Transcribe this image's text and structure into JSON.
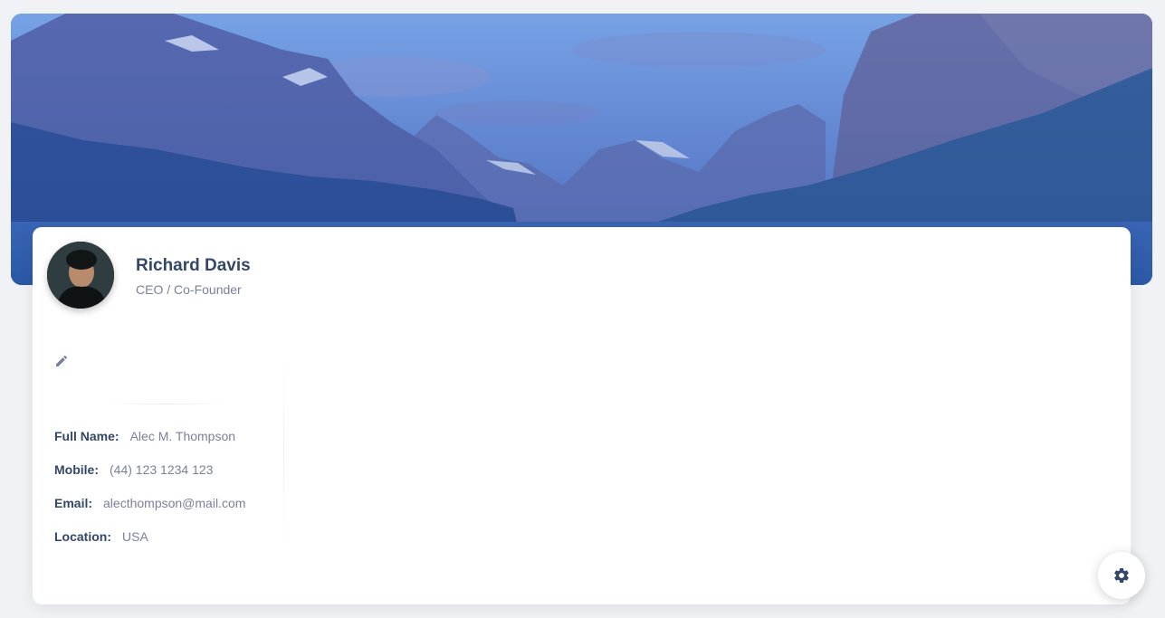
{
  "profile": {
    "name": "Richard Davis",
    "role": "CEO / Co-Founder",
    "avatar_icon": "person-avatar"
  },
  "info": {
    "full_name_label": "Full Name:",
    "full_name": "Alec M. Thompson",
    "mobile_label": "Mobile:",
    "mobile": "(44) 123 1234 123",
    "email_label": "Email:",
    "email": "alecthompson@mail.com",
    "location_label": "Location:",
    "location": "USA"
  },
  "icons": {
    "edit": "pencil-icon",
    "settings": "gear-icon"
  },
  "colors": {
    "heading": "#344767",
    "text": "#7b809a",
    "banner_tint": "#4a6fc8"
  }
}
